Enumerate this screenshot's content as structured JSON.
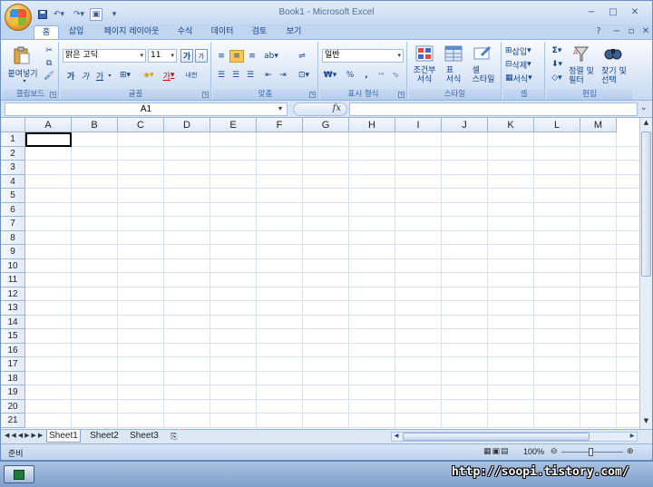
{
  "window": {
    "title": "Book1 - Microsoft Excel"
  },
  "quick_access": {
    "save_icon": "save-icon",
    "undo_icon": "undo-icon",
    "redo_icon": "redo-icon"
  },
  "tabs": [
    {
      "label": "홈"
    },
    {
      "label": "삽입"
    },
    {
      "label": "페이지 레이아웃"
    },
    {
      "label": "수식"
    },
    {
      "label": "데이터"
    },
    {
      "label": "검토"
    },
    {
      "label": "보기"
    }
  ],
  "ribbon": {
    "clipboard": {
      "label": "클립보드",
      "paste": "붙여넣기"
    },
    "font": {
      "label": "글꼴",
      "font_name": "맑은 고딕",
      "font_size": "11",
      "bold": "가",
      "italic": "가",
      "underline": "가",
      "grow": "가",
      "shrink": "가",
      "color": "가",
      "phonetic": "내천"
    },
    "alignment": {
      "label": "맞춤"
    },
    "number": {
      "label": "표시 형식",
      "format": "일반",
      "currency": "₩",
      "percent": "%",
      "comma": ","
    },
    "styles": {
      "label": "스타일",
      "conditional": "조건부\n서식",
      "table": "표\n서식",
      "cell_style": "셀\n스타일"
    },
    "cells": {
      "label": "셀",
      "insert": "삽입",
      "delete": "삭제",
      "format": "서식"
    },
    "editing": {
      "label": "편집",
      "sort": "정렬 및\n필터",
      "find": "찾기 및\n선택",
      "sigma": "Σ"
    }
  },
  "formula_bar": {
    "name_box": "A1",
    "fx": "fx",
    "content": ""
  },
  "columns": [
    "A",
    "B",
    "C",
    "D",
    "E",
    "F",
    "G",
    "H",
    "I",
    "J",
    "K",
    "L",
    "M"
  ],
  "rows": [
    "1",
    "2",
    "3",
    "4",
    "5",
    "6",
    "7",
    "8",
    "9",
    "10",
    "11",
    "12",
    "13",
    "14",
    "15",
    "16",
    "17",
    "18",
    "19",
    "20",
    "21"
  ],
  "sheets": [
    {
      "label": "Sheet1"
    },
    {
      "label": "Sheet2"
    },
    {
      "label": "Sheet3"
    }
  ],
  "status": {
    "mode": "준비",
    "zoom": "100%"
  },
  "watermark": "http://soopi.tistory.com/"
}
